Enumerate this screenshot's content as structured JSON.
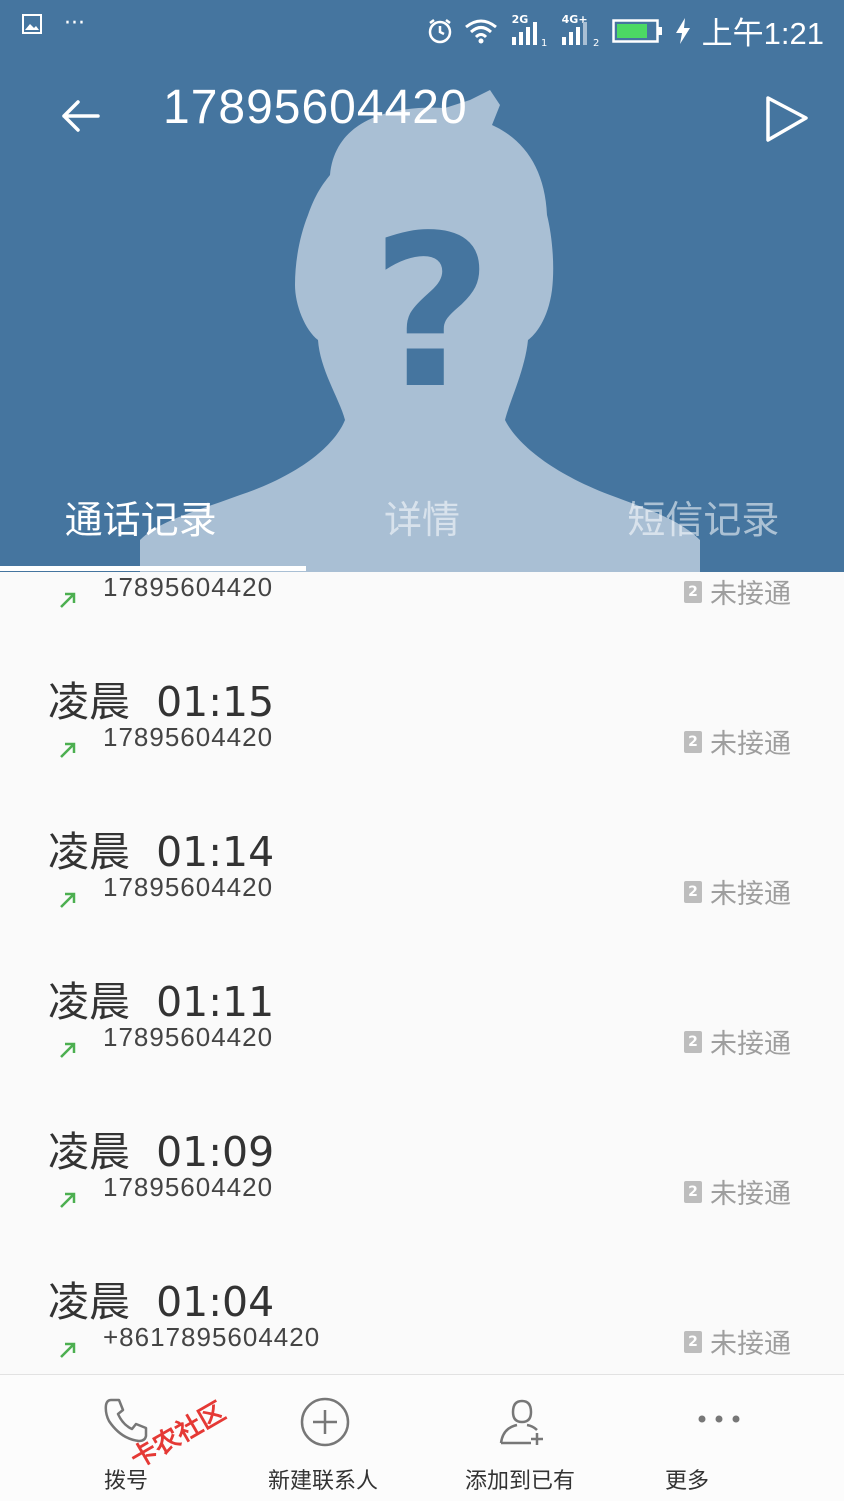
{
  "status_bar": {
    "time": "上午1:21",
    "sim1_network": "2G",
    "sim2_network": "4G+"
  },
  "header": {
    "title": "17895604420"
  },
  "tabs": [
    {
      "label": "通话记录"
    },
    {
      "label": "详情"
    },
    {
      "label": "短信记录"
    }
  ],
  "calls": [
    {
      "time": "",
      "number": "17895604420",
      "status": "未接通",
      "sim": "2"
    },
    {
      "time": "凌晨  01:15",
      "number": "17895604420",
      "status": "未接通",
      "sim": "2"
    },
    {
      "time": "凌晨  01:14",
      "number": "17895604420",
      "status": "未接通",
      "sim": "2"
    },
    {
      "time": "凌晨  01:11",
      "number": "17895604420",
      "status": "未接通",
      "sim": "2"
    },
    {
      "time": "凌晨  01:09",
      "number": "17895604420",
      "status": "未接通",
      "sim": "2"
    },
    {
      "time": "凌晨  01:04",
      "number": "+8617895604420",
      "status": "未接通",
      "sim": "2"
    }
  ],
  "bottom_bar": {
    "dial": "拨号",
    "new_contact": "新建联系人",
    "add_existing": "添加到已有",
    "more": "更多"
  },
  "watermark": "卡农社区",
  "colors": {
    "header_bg": "#45759f",
    "silhouette": "#a9bfd4",
    "outgoing_arrow": "#4caf50",
    "status_gray": "#9e9e9e"
  }
}
